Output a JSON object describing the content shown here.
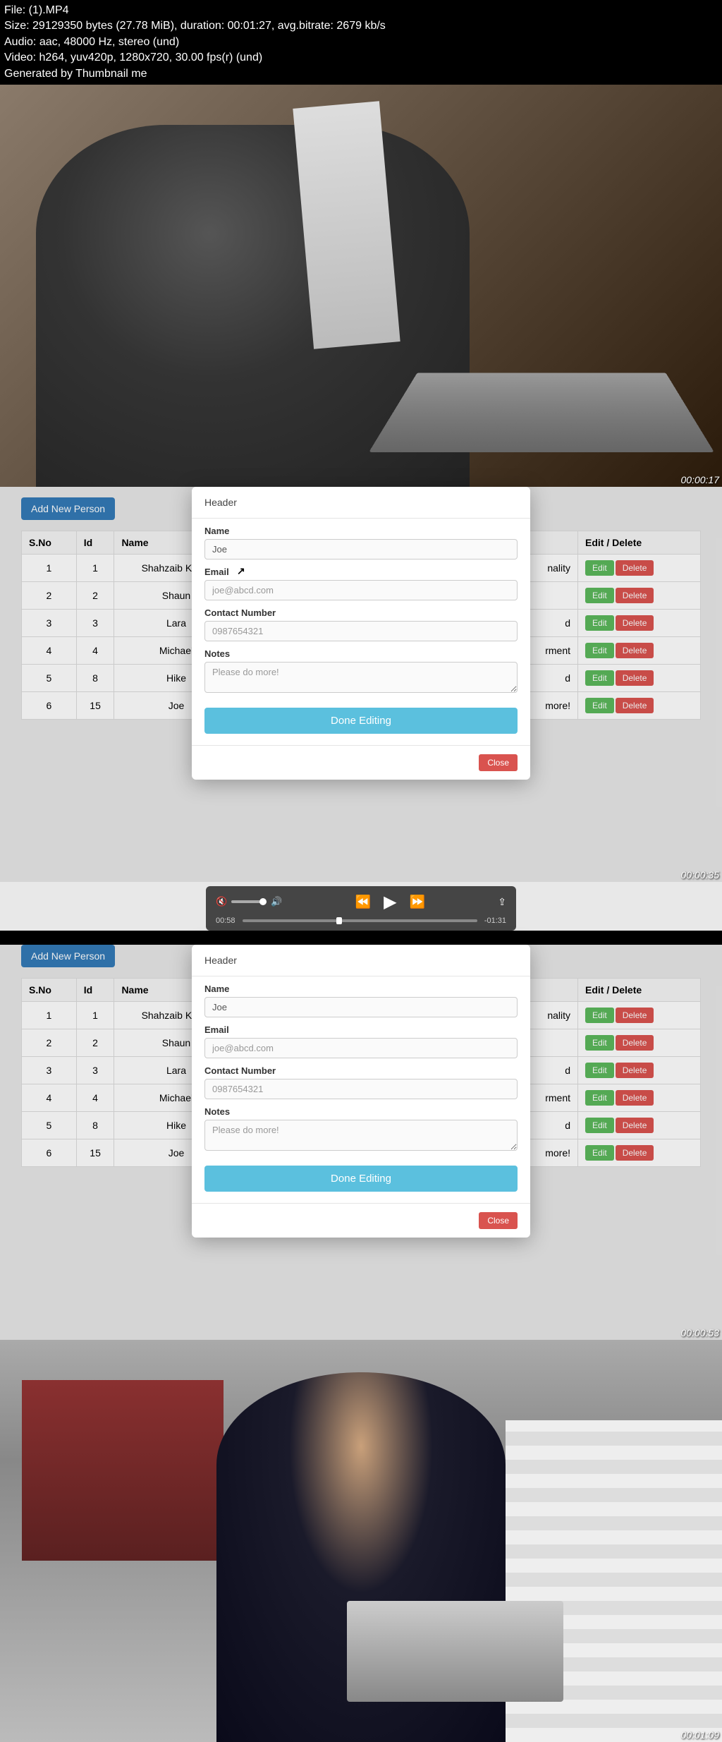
{
  "meta": {
    "file_line": "File:  (1).MP4",
    "size_line": "Size: 29129350 bytes (27.78 MiB), duration: 00:01:27, avg.bitrate: 2679 kb/s",
    "audio_line": "Audio: aac, 48000 Hz, stereo (und)",
    "video_line": "Video: h264, yuv420p, 1280x720, 30.00 fps(r) (und)",
    "gen_line": "Generated by Thumbnail me"
  },
  "timestamps": {
    "t1": "00:00:17",
    "t2": "00:00:35",
    "t3": "00:00:53",
    "t4": "00:01:09"
  },
  "buttons": {
    "add_person": "Add New Person",
    "edit": "Edit",
    "delete": "Delete",
    "done": "Done Editing",
    "close": "Close"
  },
  "table": {
    "headers": {
      "sno": "S.No",
      "id": "Id",
      "name": "Name",
      "extra": "nality",
      "action": "Edit / Delete"
    },
    "rows": [
      {
        "sno": "1",
        "id": "1",
        "name": "Shahzaib Kama",
        "extra": "nality"
      },
      {
        "sno": "2",
        "id": "2",
        "name": "Shaun",
        "extra": ""
      },
      {
        "sno": "3",
        "id": "3",
        "name": "Lara",
        "extra": "d"
      },
      {
        "sno": "4",
        "id": "4",
        "name": "Michael",
        "extra": "rment"
      },
      {
        "sno": "5",
        "id": "8",
        "name": "Hike",
        "extra": "d"
      },
      {
        "sno": "6",
        "id": "15",
        "name": "Joe",
        "extra": "more!"
      }
    ]
  },
  "modal": {
    "header": "Header",
    "labels": {
      "name": "Name",
      "email": "Email",
      "contact": "Contact Number",
      "notes": "Notes"
    },
    "values": {
      "name": "Joe",
      "email": "joe@abcd.com",
      "contact": "0987654321",
      "notes": "Please do more!"
    }
  },
  "player": {
    "current": "00:58",
    "remaining": "-01:31"
  }
}
